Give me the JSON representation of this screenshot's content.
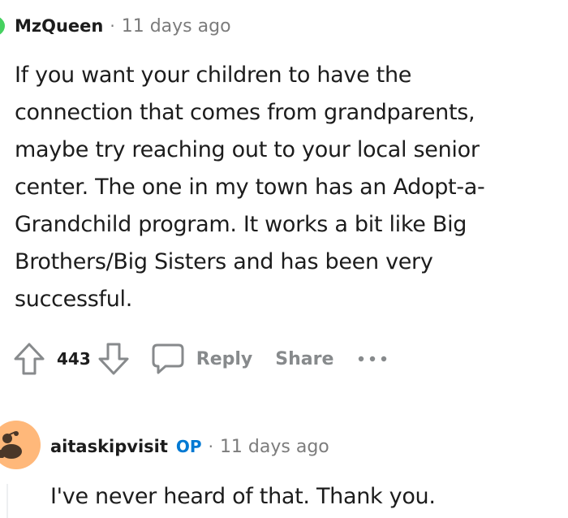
{
  "comments": [
    {
      "author": "MzQueen",
      "separator": "·",
      "timestamp": "11 days ago",
      "body_lines": [
        "If you want your children to have the",
        "connection that comes from grandparents,",
        "maybe try reaching out to your local senior",
        "center. The one in my town has an Adopt-a-",
        "Grandchild program. It works a bit like Big",
        "Brothers/Big Sisters and has been very",
        "successful."
      ],
      "vote_count": "443",
      "actions": {
        "reply_label": "Reply",
        "share_label": "Share",
        "more_label": "more options"
      },
      "avatar_icon": "user-avatar-icon",
      "avatar_color": "#46d160"
    },
    {
      "author": "aitaskipvisit",
      "badge": "OP",
      "separator": "·",
      "timestamp": "11 days ago",
      "body": "I've never heard of that. Thank you.",
      "avatar_icon": "snoo-avatar-icon",
      "avatar_color": "#ffb87a"
    }
  ],
  "colors": {
    "text_primary": "#1c1c1c",
    "text_muted": "#7c7c7c",
    "action_gray": "#878a8c",
    "op_blue": "#0079d3"
  }
}
